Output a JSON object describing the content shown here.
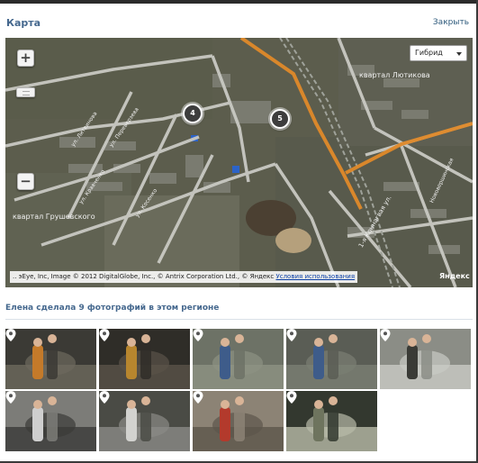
{
  "window": {
    "title": "Карта",
    "close_label": "Закрыть"
  },
  "map": {
    "zoom_in": "+",
    "zoom_out": "−",
    "map_type": "Гибрид",
    "clusters": [
      {
        "count": "4"
      },
      {
        "count": "5"
      }
    ],
    "labels": {
      "quarter_top": "квартал Лютикова",
      "quarter_left": "квартал Грушевского",
      "street_1": "ул. Литвинова",
      "street_2": "ул. Переверзева",
      "street_3": "ул. Кравченко",
      "street_4": "ул. Косенко",
      "street_5": "1-я Коннагвая ул.",
      "street_6": "Нововершинская"
    },
    "copyright": ".. эEye, Inc, Image © 2012 DigitalGlobe, Inc., © Antrix Corporation Ltd., © Яндекс ",
    "terms_link": "Условия использования",
    "logo": "Яндекс"
  },
  "photos": {
    "heading": "Елена сделала 9 фотографий в этом регионе",
    "items": [
      {
        "icon": "map-pin-icon",
        "colors": [
          "#3b3a35",
          "#c47a2a",
          "#6e6a5e"
        ]
      },
      {
        "icon": "map-pin-icon",
        "colors": [
          "#2f2d28",
          "#b8862e",
          "#5a5348"
        ]
      },
      {
        "icon": "map-pin-icon",
        "colors": [
          "#6d7266",
          "#3e5c8a",
          "#8d9283"
        ]
      },
      {
        "icon": "map-pin-icon",
        "colors": [
          "#5a5d55",
          "#3e5c8a",
          "#7b7f73"
        ]
      },
      {
        "icon": "map-pin-icon",
        "colors": [
          "#8b8d86",
          "#3a3b36",
          "#c9cac4"
        ]
      },
      {
        "icon": "map-pin-icon",
        "colors": [
          "#7c7c78",
          "#cfcfcf",
          "#3a3a38"
        ]
      },
      {
        "icon": "map-pin-icon",
        "colors": [
          "#4a4b45",
          "#d2d2cf",
          "#8a8a86"
        ]
      },
      {
        "icon": "map-pin-icon",
        "colors": [
          "#8c8375",
          "#b33a2c",
          "#5c564b"
        ]
      },
      {
        "icon": "map-pin-icon",
        "colors": [
          "#33382f",
          "#6e745e",
          "#b8baa8"
        ]
      }
    ]
  },
  "colors": {
    "accent": "#45688e",
    "link": "#2b587a",
    "road_major": "#e08a2a"
  }
}
